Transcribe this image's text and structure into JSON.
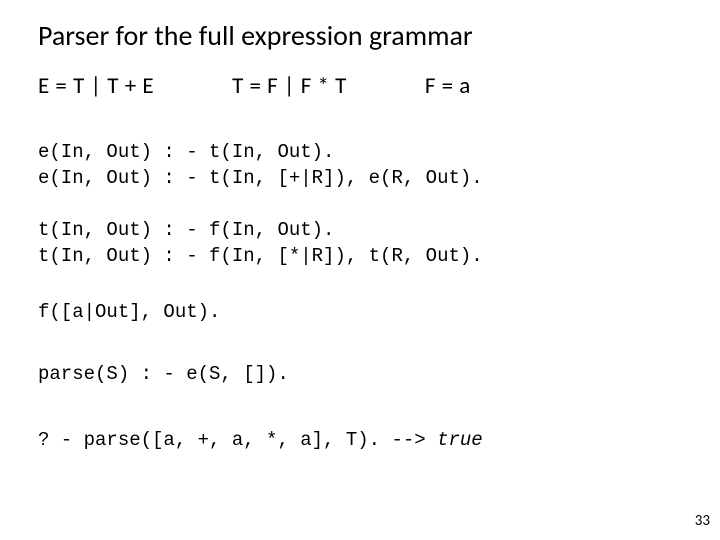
{
  "title": "Parser for the full expression grammar",
  "grammar": {
    "e": "E = T | T + E",
    "t": "T = F | F * T",
    "f": "F = a"
  },
  "code": {
    "block1": "e(In, Out) : - t(In, Out).\ne(In, Out) : - t(In, [+|R]), e(R, Out).",
    "block2": "t(In, Out) : - f(In, Out).\nt(In, Out) : - f(In, [*|R]), t(R, Out).",
    "block3": "f([a|Out], Out).",
    "block4": "parse(S) : - e(S, []).",
    "query": "? - parse([a, +, a, *, a], T). --> ",
    "result": "true"
  },
  "pagenum": "33"
}
